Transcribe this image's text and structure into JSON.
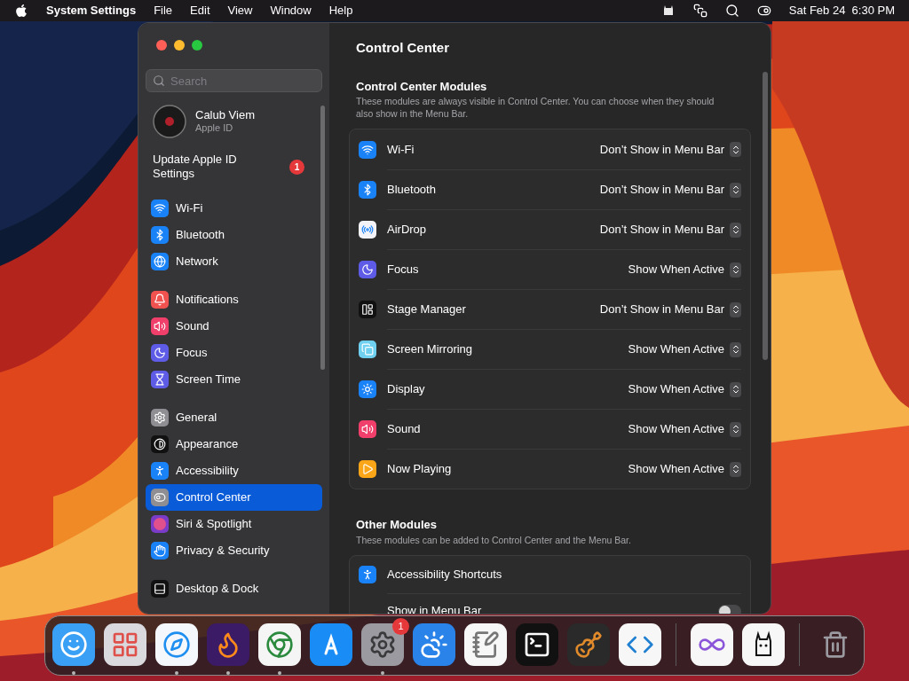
{
  "menu_bar": {
    "app": "System Settings",
    "menus": [
      "File",
      "Edit",
      "View",
      "Window",
      "Help"
    ],
    "clock": "Sat Feb 24  6:30 PM"
  },
  "sidebar": {
    "search": {
      "placeholder": "Search"
    },
    "account": {
      "name": "Calub Viem",
      "subtitle": "Apple ID"
    },
    "notice": {
      "text": "Update Apple ID Settings",
      "badge": "1"
    },
    "groups": [
      [
        {
          "label": "Wi-Fi",
          "selected": false
        },
        {
          "label": "Bluetooth",
          "selected": false
        },
        {
          "label": "Network",
          "selected": false
        }
      ],
      [
        {
          "label": "Notifications",
          "selected": false
        },
        {
          "label": "Sound",
          "selected": false
        },
        {
          "label": "Focus",
          "selected": false
        },
        {
          "label": "Screen Time",
          "selected": false
        }
      ],
      [
        {
          "label": "General",
          "selected": false
        },
        {
          "label": "Appearance",
          "selected": false
        },
        {
          "label": "Accessibility",
          "selected": false
        },
        {
          "label": "Control Center",
          "selected": true
        },
        {
          "label": "Siri & Spotlight",
          "selected": false
        },
        {
          "label": "Privacy & Security",
          "selected": false
        }
      ],
      [
        {
          "label": "Desktop & Dock",
          "selected": false
        }
      ]
    ]
  },
  "content": {
    "title": "Control Center",
    "modules": {
      "title": "Control Center Modules",
      "description": "These modules are always visible in Control Center. You can choose when they should also show in the Menu Bar.",
      "rows": [
        {
          "label": "Wi-Fi",
          "value": "Don’t Show in Menu Bar"
        },
        {
          "label": "Bluetooth",
          "value": "Don’t Show in Menu Bar"
        },
        {
          "label": "AirDrop",
          "value": "Don’t Show in Menu Bar"
        },
        {
          "label": "Focus",
          "value": "Show When Active"
        },
        {
          "label": "Stage Manager",
          "value": "Don’t Show in Menu Bar"
        },
        {
          "label": "Screen Mirroring",
          "value": "Show When Active"
        },
        {
          "label": "Display",
          "value": "Show When Active"
        },
        {
          "label": "Sound",
          "value": "Show When Active"
        },
        {
          "label": "Now Playing",
          "value": "Show When Active"
        }
      ]
    },
    "other": {
      "title": "Other Modules",
      "description": "These modules can be added to Control Center and the Menu Bar.",
      "rows": [
        {
          "kind": "header",
          "label": "Accessibility Shortcuts"
        },
        {
          "kind": "toggle",
          "label": "Show in Menu Bar",
          "on": false
        }
      ]
    }
  },
  "dock": {
    "groups": [
      [
        {
          "running": true
        },
        {
          "running": false
        },
        {
          "running": true
        },
        {
          "running": true
        },
        {
          "running": true
        },
        {
          "running": false
        },
        {
          "running": true,
          "badge": "1"
        },
        {
          "running": false
        },
        {
          "running": false
        },
        {
          "running": false
        },
        {
          "running": false
        },
        {
          "running": false
        }
      ],
      [
        {
          "running": false
        },
        {
          "running": false
        }
      ],
      [
        {
          "running": false
        }
      ]
    ]
  }
}
